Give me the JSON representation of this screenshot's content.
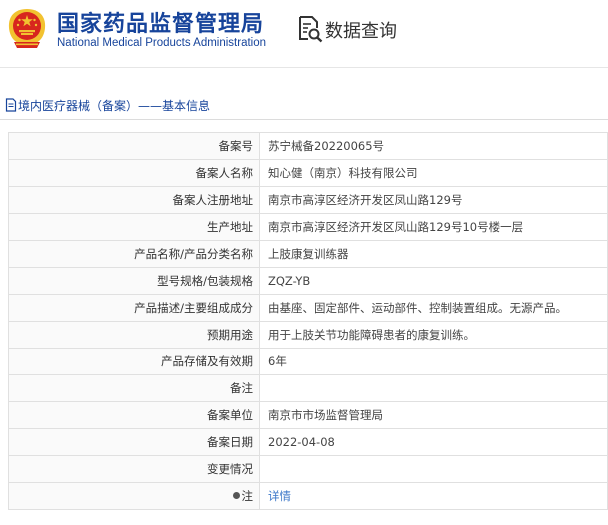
{
  "header": {
    "brand_cn": "国家药品监督管理局",
    "brand_en": "National Medical Products Administration",
    "query_title": "数据查询",
    "emblem_icon": "national-emblem-icon",
    "query_icon": "document-search-icon"
  },
  "breadcrumb": {
    "text": "境内医疗器械（备案）——基本信息",
    "icon": "document-icon"
  },
  "colors": {
    "brand_blue": "#17449b",
    "link_blue": "#3a76c8",
    "emblem_red": "#d7261e",
    "emblem_gold": "#f2c230"
  },
  "rows": [
    {
      "label": "备案号",
      "value": "苏宁械备20220065号"
    },
    {
      "label": "备案人名称",
      "value": "知心健（南京）科技有限公司"
    },
    {
      "label": "备案人注册地址",
      "value": "南京市高淳区经济开发区凤山路129号"
    },
    {
      "label": "生产地址",
      "value": "南京市高淳区经济开发区凤山路129号10号楼一层"
    },
    {
      "label": "产品名称/产品分类名称",
      "value": "上肢康复训练器"
    },
    {
      "label": "型号规格/包装规格",
      "value": "ZQZ-YB"
    },
    {
      "label": "产品描述/主要组成成分",
      "value": "由基座、固定部件、运动部件、控制装置组成。无源产品。"
    },
    {
      "label": "预期用途",
      "value": "用于上肢关节功能障碍患者的康复训练。"
    },
    {
      "label": "产品存储及有效期",
      "value": "6年"
    },
    {
      "label": "备注",
      "value": ""
    },
    {
      "label": "备案单位",
      "value": "南京市市场监督管理局"
    },
    {
      "label": "备案日期",
      "value": "2022-04-08"
    },
    {
      "label": "变更情况",
      "value": ""
    },
    {
      "label": "注",
      "value": "详情"
    }
  ]
}
